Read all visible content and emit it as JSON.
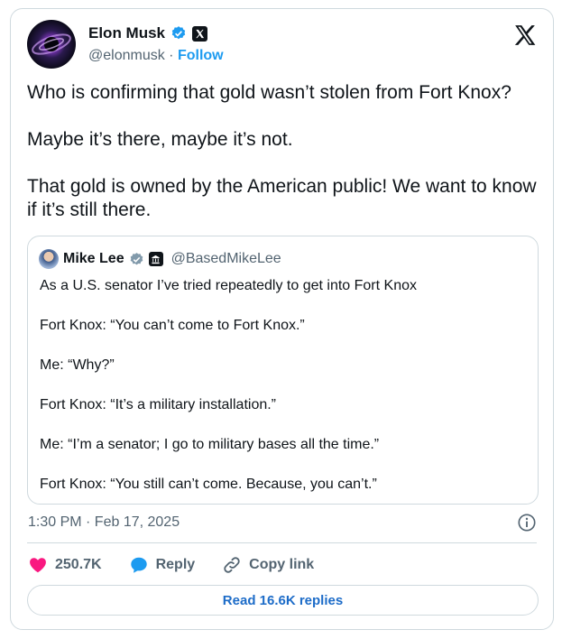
{
  "author": {
    "name": "Elon Musk",
    "handle": "@elonmusk",
    "separator": "·",
    "follow_label": "Follow"
  },
  "tweet": {
    "paragraphs": [
      "Who is confirming that gold wasn’t stolen from Fort Knox?",
      "Maybe it’s there, maybe it’s not.",
      "That gold is owned by the American public! We want to know if it’s still there."
    ],
    "timestamp": "1:30 PM · Feb 17, 2025"
  },
  "quote": {
    "name": "Mike Lee",
    "handle": "@BasedMikeLee",
    "lines": [
      "As a U.S. senator I’ve tried repeatedly to get into Fort Knox",
      "Fort Knox: “You can’t come to Fort Knox.”",
      "Me: “Why?”",
      "Fort Knox: “It’s a military installation.”",
      "Me: “I’m a senator; I go to military bases all the time.”",
      "Fort Knox: “You still can’t come. Because, you can’t.”"
    ]
  },
  "actions": {
    "like_count": "250.7K",
    "reply_label": "Reply",
    "copy_link_label": "Copy link"
  },
  "read_replies_label": "Read 16.6K replies",
  "colors": {
    "accent": "#1d9bf0",
    "like": "#f91880",
    "text": "#0f1419",
    "muted": "#536471",
    "border": "#cfd9de"
  },
  "icons": [
    "verified-badge-icon",
    "x-logo-icon",
    "info-icon",
    "heart-icon",
    "reply-bubble-icon",
    "link-icon",
    "government-badge-icon"
  ]
}
